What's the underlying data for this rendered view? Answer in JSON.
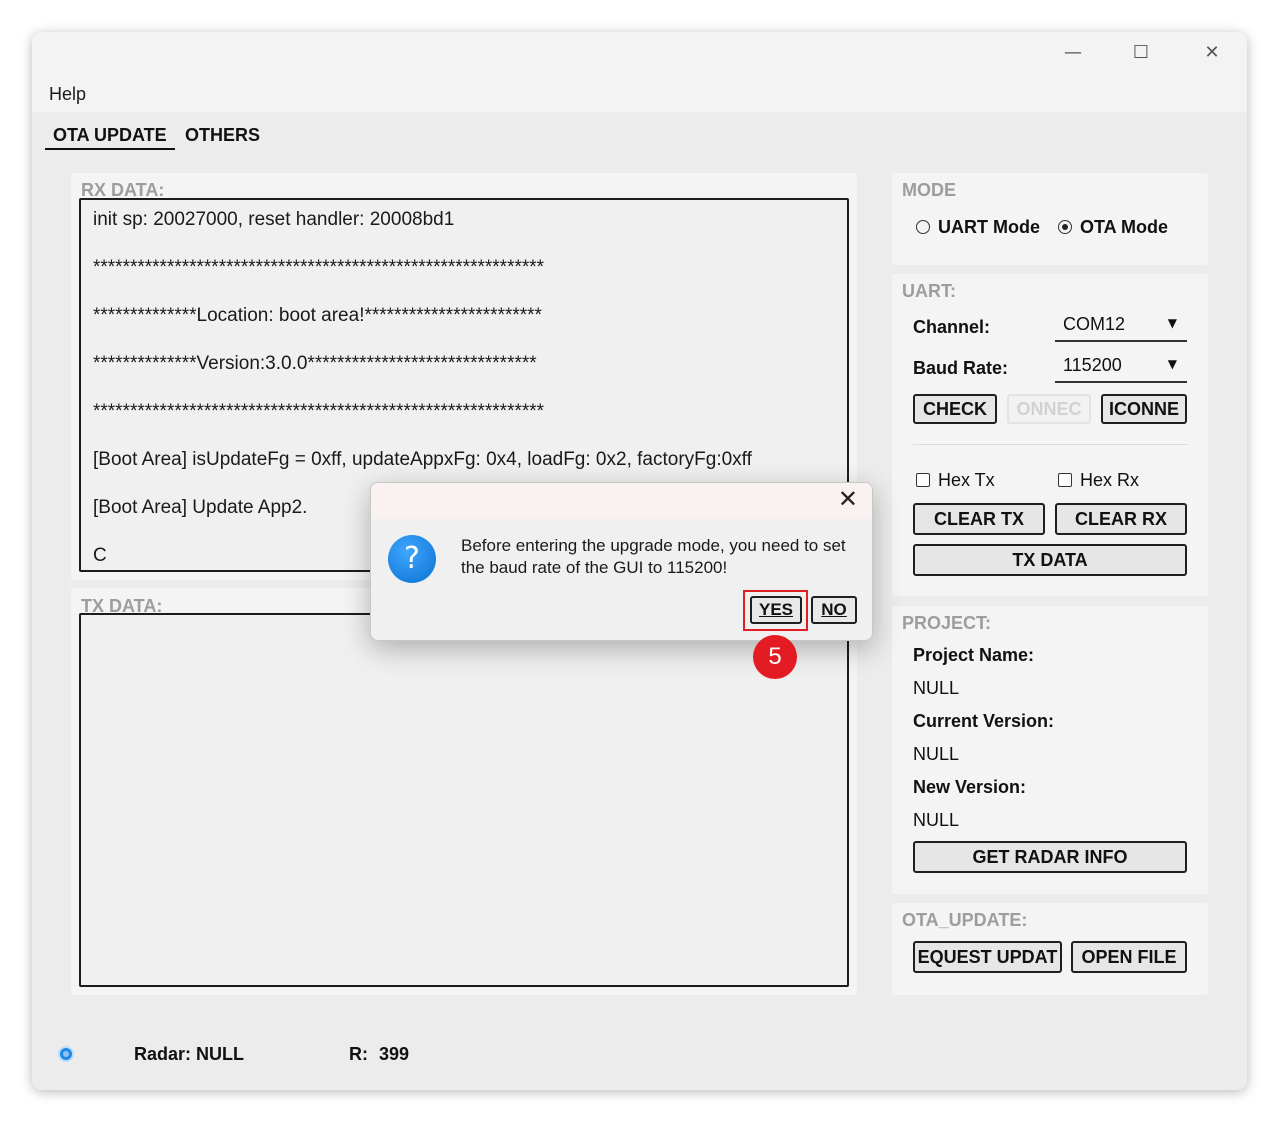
{
  "window": {
    "minimize": "—",
    "maximize": "☐",
    "close": "✕"
  },
  "menu": {
    "help": "Help"
  },
  "tabs": [
    {
      "label": "OTA UPDATE"
    },
    {
      "label": "OTHERS"
    }
  ],
  "rx": {
    "title": "RX DATA:",
    "lines": [
      "init sp: 20027000, reset handler: 20008bd1",
      "*************************************************************",
      "**************Location: boot area!************************",
      "**************Version:3.0.0*******************************",
      "*************************************************************",
      "[Boot Area] isUpdateFg = 0xff, updateAppxFg: 0x4, loadFg: 0x2, factoryFg:0xff",
      "[Boot Area] Update App2.",
      "C"
    ]
  },
  "tx": {
    "title": "TX DATA:"
  },
  "mode": {
    "title": "MODE",
    "uart_label": "UART Mode",
    "ota_label": "OTA Mode",
    "selected": "OTA Mode"
  },
  "uart": {
    "title": "UART:",
    "channel_label": "Channel:",
    "channel_value": "COM12",
    "baud_label": "Baud Rate:",
    "baud_value": "115200",
    "check_btn": "CHECK",
    "connect_btn": "ONNEC",
    "disconnect_btn": "ICONNE",
    "hex_tx": "Hex Tx",
    "hex_rx": "Hex Rx",
    "clear_tx": "CLEAR TX",
    "clear_rx": "CLEAR RX",
    "tx_data": "TX DATA"
  },
  "project": {
    "title": "PROJECT:",
    "name_label": "Project Name:",
    "name_value": "NULL",
    "current_label": "Current Version:",
    "current_value": "NULL",
    "new_label": "New Version:",
    "new_value": "NULL",
    "get_info_btn": "GET RADAR INFO"
  },
  "ota": {
    "title": "OTA_UPDATE:",
    "request_btn": "EQUEST UPDAT",
    "open_btn": "OPEN FILE"
  },
  "status": {
    "radar_label": "Radar:",
    "radar_value": "NULL",
    "r_label": "R:",
    "r_value": "399"
  },
  "dialog": {
    "close": "✕",
    "icon": "?",
    "message": "Before entering the upgrade mode, you need to set the baud rate of the GUI to 115200!",
    "yes": "YES",
    "no": "NO"
  },
  "annotation": {
    "step": "5",
    "highlight_color": "#e02020"
  }
}
